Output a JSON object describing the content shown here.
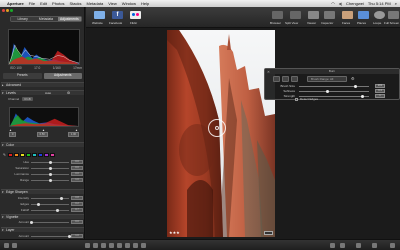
{
  "menubar": {
    "app_name": "Aperture",
    "items": [
      "File",
      "Edit",
      "Photos",
      "Stacks",
      "Metadata",
      "View",
      "Window",
      "Help"
    ],
    "user": "Chengwei",
    "clock": "Thu 5:14 PM"
  },
  "window": {
    "title": "Aperture"
  },
  "inspector": {
    "tabs": [
      "Library",
      "Metadata",
      "Adjustments"
    ],
    "active_tab": "Adjustments",
    "meta": [
      "ISO 100",
      "17.0",
      "1/160",
      "17mm"
    ],
    "section_tabs": [
      "Presets",
      "Adjustments"
    ],
    "sections": {
      "advanced": "Advanced",
      "levels": "Levels",
      "color": "Color",
      "edge_sharpen": "Edge Sharpen",
      "vignette": "Vignette",
      "layer": "Layer"
    },
    "levels_controls": {
      "auto": "Auto",
      "channel_label": "Channel",
      "channel_value": "RGB"
    },
    "levels_values": [
      "0",
      "0.50",
      "1.00"
    ],
    "color_controls": [
      {
        "label": "Hue",
        "value": "0.0",
        "level": 0.5
      },
      {
        "label": "Saturation",
        "value": "0.0",
        "level": 0.5
      },
      {
        "label": "Luminance",
        "value": "0.0",
        "level": 0.5
      },
      {
        "label": "Range",
        "value": "1.0",
        "level": 0.5
      }
    ],
    "swatch_colors": [
      "#e02020",
      "#f08a1c",
      "#e8e020",
      "#20c020",
      "#20c0c0",
      "#2040e0",
      "#a030d0",
      "#e040a0"
    ],
    "edge_controls": [
      {
        "label": "Intensity",
        "value": "0.8",
        "level": 0.8
      },
      {
        "label": "Edges",
        "value": "0.2",
        "level": 0.2
      },
      {
        "label": "Falloff",
        "value": "0.7",
        "level": 0.7
      }
    ],
    "vignette_controls": [
      {
        "label": "Amount",
        "value": "0.0",
        "level": 0.0
      }
    ],
    "layer_controls": [
      {
        "label": "Amount",
        "value": "1.0",
        "level": 1.0
      }
    ]
  },
  "toolbar": {
    "left_buttons": [
      "Website",
      "Facebook",
      "Flickr"
    ],
    "right_buttons": [
      "Browser",
      "Split View",
      "Viewer",
      "Inspector",
      "Faces",
      "Places",
      "Loupe",
      "Full Screen"
    ]
  },
  "viewer": {
    "rating": "★★★"
  },
  "brush_hud": {
    "title": "Burn",
    "mode": "Brush Range: All",
    "controls": [
      {
        "label": "Brush Size",
        "value": "200",
        "level": 0.8
      },
      {
        "label": "Softness",
        "value": "0.4",
        "level": 0.4
      },
      {
        "label": "Strength",
        "value": "1",
        "level": 0.9
      }
    ],
    "detect_edges": "Detect Edges"
  },
  "colors": {
    "accent": "#3d7ad8",
    "photo_brick": "#b5452a"
  }
}
